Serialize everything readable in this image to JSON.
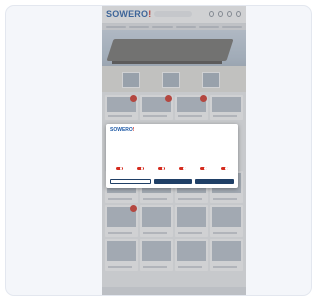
{
  "site": {
    "brand_main": "SOWERO",
    "brand_accent": "!"
  },
  "hero": {
    "headline": ""
  },
  "cookie_banner": {
    "brand_main": "SOWERO",
    "brand_accent": "!",
    "title": "",
    "body": "",
    "categories": [
      {
        "label": ""
      },
      {
        "label": ""
      },
      {
        "label": ""
      },
      {
        "label": ""
      },
      {
        "label": ""
      },
      {
        "label": ""
      }
    ],
    "buttons": [
      {
        "label": ""
      },
      {
        "label": ""
      },
      {
        "label": ""
      }
    ]
  },
  "colors": {
    "brand_blue": "#1f5aa6",
    "brand_red": "#d52b1e",
    "button_dark": "#1f3f66"
  }
}
